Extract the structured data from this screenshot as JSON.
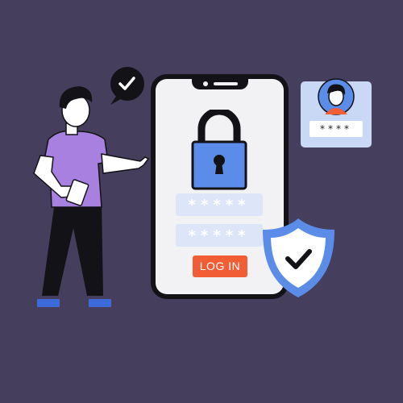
{
  "login": {
    "password_mask_1": "*****",
    "password_mask_2": "*****",
    "login_label": "LOG IN"
  },
  "profile": {
    "pin_mask": "****"
  },
  "colors": {
    "background": "#453e5c",
    "accent_blue": "#5b8de8",
    "login_orange": "#f15d35",
    "shirt_purple": "#a881e0"
  },
  "icons": [
    "check-bubble-icon",
    "padlock-icon",
    "shield-check-icon",
    "user-avatar-icon"
  ]
}
